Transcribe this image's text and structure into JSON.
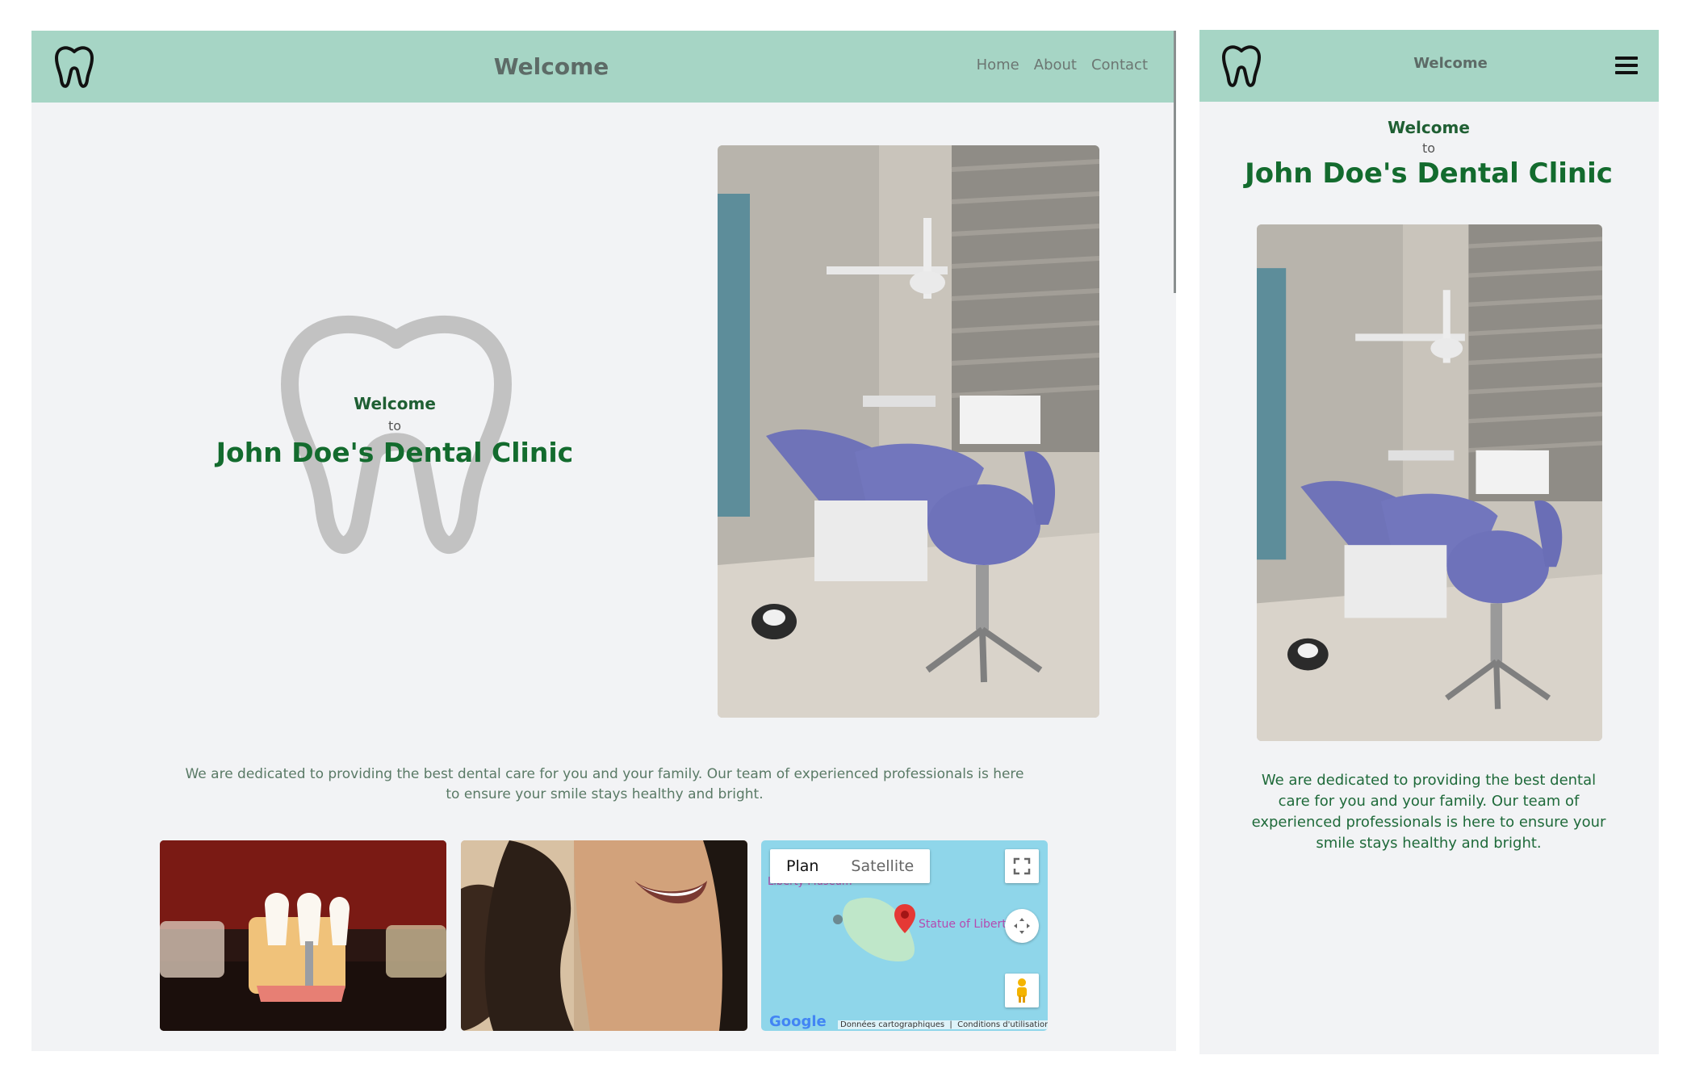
{
  "desktop": {
    "header": {
      "title": "Welcome",
      "nav": [
        "Home",
        "About",
        "Contact"
      ]
    },
    "hero": {
      "welcome": "Welcome",
      "to": "to",
      "clinic_name": "John Doe's Dental Clinic"
    },
    "intro": "We are dedicated to providing the best dental care for you and your family. Our team of experienced professionals is here to ensure your smile stays healthy and bright.",
    "map": {
      "tabs": [
        "Plan",
        "Satellite"
      ],
      "place_label": "Statue of Libert",
      "place_label_2": "Liberty Museum",
      "google_logo": "Google",
      "footer_data": "Données cartographiques",
      "footer_terms": "Conditions d'utilisation"
    }
  },
  "mobile": {
    "header": {
      "title": "Welcome"
    },
    "hero": {
      "welcome": "Welcome",
      "to": "to",
      "clinic_name": "John Doe's Dental Clinic"
    },
    "intro": "We are dedicated to providing the best dental care for you and your family. Our team of experienced professionals is here to ensure your smile stays healthy and bright."
  },
  "colors": {
    "header_bg": "#a6d5c5",
    "page_bg": "#f2f3f5",
    "accent_green": "#136b2e",
    "map_water": "#8fd6ea",
    "map_island": "#bfe7c9",
    "pin_red": "#e53935"
  },
  "icons": [
    "tooth-logo-icon",
    "tooth-watermark-icon",
    "hamburger-menu-icon",
    "fullscreen-icon",
    "camera-control-icon",
    "pegman-icon",
    "map-pin-icon"
  ]
}
